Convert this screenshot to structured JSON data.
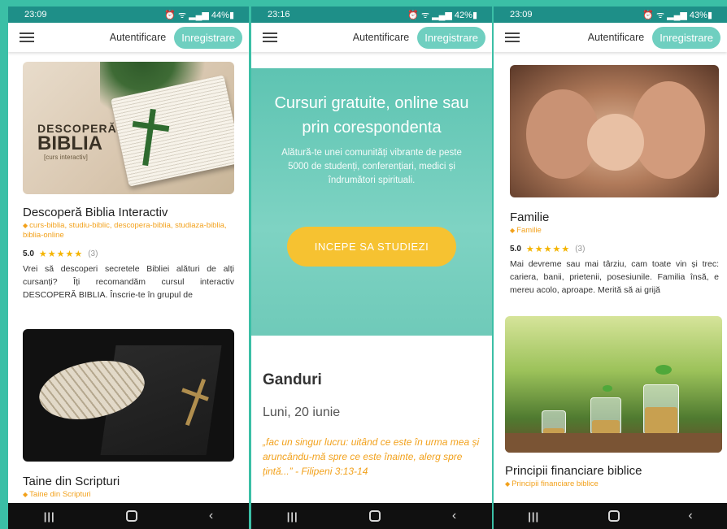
{
  "screens": [
    {
      "status": {
        "time": "23:09",
        "battery": "44%"
      },
      "appbar": {
        "login": "Autentificare",
        "register": "Inregistrare"
      },
      "cards": [
        {
          "title": "Descoperă Biblia Interactiv",
          "tags": "curs-biblia, studiu-biblic, descopera-biblia, studiaza-biblia, biblia-online",
          "score": "5.0",
          "stars": "★★★★★",
          "count": "(3)",
          "description": "Vrei să descoperi secretele Bibliei alături de alți cursanți? Îți recomandăm cursul interactiv DESCOPERĂ BIBLIA. Înscrie-te în grupul de",
          "image_text": {
            "line1": "DESCOPERĂ",
            "line2": "BIBLIA",
            "line3": "[curs interactiv]"
          }
        },
        {
          "title": "Taine din Scripturi",
          "tags": "Taine din Scripturi"
        }
      ]
    },
    {
      "status": {
        "time": "23:16",
        "battery": "42%"
      },
      "appbar": {
        "login": "Autentificare",
        "register": "Inregistrare"
      },
      "hero": {
        "title": "Cursuri gratuite, online sau prin corespondenta",
        "subtitle": "Alătură-te unei comunități vibrante de peste 5000 de studenți, conferențiari, medici și îndrumători spirituali.",
        "cta": "INCEPE SA STUDIEZI"
      },
      "ganduri": {
        "title": "Ganduri",
        "date": "Luni, 20 iunie",
        "quote": "„fac un singur lucru: uitând ce este în urma mea și aruncându-mă spre ce este înainte, alerg spre țintă...” - Filipeni 3:13-14"
      }
    },
    {
      "status": {
        "time": "23:09",
        "battery": "43%"
      },
      "appbar": {
        "login": "Autentificare",
        "register": "Inregistrare"
      },
      "cards": [
        {
          "title": "Familie",
          "tags": "Familie",
          "score": "5.0",
          "stars": "★★★★★",
          "count": "(3)",
          "description": "Mai devreme sau mai târziu, cam toate vin și trec: cariera, banii, prietenii, posesiunile. Familia însă, e mereu acolo, aproape. Merită să ai grijă"
        },
        {
          "title": "Principii financiare biblice",
          "tags": "Principii financiare biblice"
        }
      ]
    }
  ],
  "icons": {
    "tag": "tag-icon",
    "menu": "hamburger-menu-icon",
    "nav_recents": "recents-icon",
    "nav_home": "home-icon",
    "nav_back": "back-icon"
  },
  "colors": {
    "accent": "#6fcfc0",
    "tag": "#f2a11b",
    "cta": "#f6c231",
    "background": "#3bbfa6"
  }
}
